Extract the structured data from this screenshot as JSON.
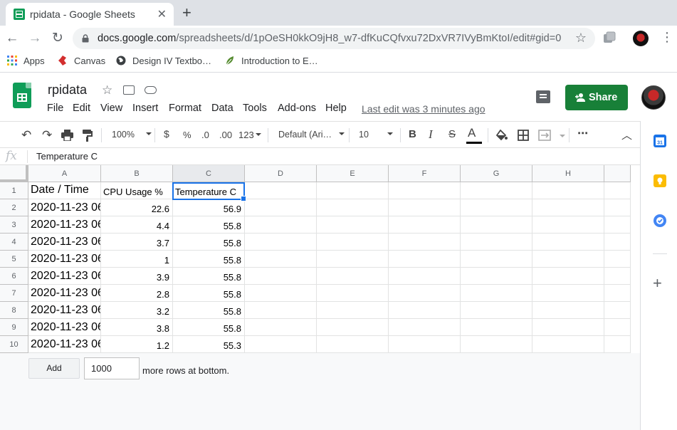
{
  "browser": {
    "tab_title": "rpidata - Google Sheets",
    "url_host": "docs.google.com",
    "url_path": "/spreadsheets/d/1pOeSH0kkO9jH8_w7-dfKuCQfvxu72DxVR7IVyBmKtoI/edit#gid=0",
    "bookmarks": [
      "Apps",
      "Canvas",
      "Design IV Textbo…",
      "Introduction to E…"
    ]
  },
  "sheets": {
    "title": "rpidata",
    "menu": [
      "File",
      "Edit",
      "View",
      "Insert",
      "Format",
      "Data",
      "Tools",
      "Add-ons",
      "Help"
    ],
    "last_edit": "Last edit was 3 minutes ago",
    "share_label": "Share"
  },
  "toolbar": {
    "zoom": "100%",
    "currency": "$",
    "percent": "%",
    "dec_decrease": ".0",
    "dec_increase": ".00",
    "number_format": "123",
    "font": "Default (Ari…",
    "font_size": "10",
    "bold": "B",
    "italic": "I",
    "strike": "S",
    "text_color": "A",
    "more": "⋯"
  },
  "formula_bar": {
    "fx": "fx",
    "value": "Temperature C"
  },
  "grid": {
    "columns": [
      "A",
      "B",
      "C",
      "D",
      "E",
      "F",
      "G",
      "H"
    ],
    "rows": [
      [
        "Date / Time",
        "CPU Usage %",
        "Temperature C"
      ],
      [
        "2020-11-23 06",
        "22.6",
        "56.9"
      ],
      [
        "2020-11-23 06",
        "4.4",
        "55.8"
      ],
      [
        "2020-11-23 06",
        "3.7",
        "55.8"
      ],
      [
        "2020-11-23 06",
        "1",
        "55.8"
      ],
      [
        "2020-11-23 06",
        "3.9",
        "55.8"
      ],
      [
        "2020-11-23 06",
        "2.8",
        "55.8"
      ],
      [
        "2020-11-23 06",
        "3.2",
        "55.8"
      ],
      [
        "2020-11-23 06",
        "3.8",
        "55.8"
      ],
      [
        "2020-11-23 06",
        "1.2",
        "55.3"
      ]
    ],
    "row_numbers": [
      "1",
      "2",
      "3",
      "4",
      "5",
      "6",
      "7",
      "8",
      "9",
      "10"
    ]
  },
  "add_rows": {
    "button_label": "Add",
    "count": "1000",
    "suffix": "more rows at bottom."
  },
  "colors": {
    "share_green": "#188038",
    "selection_blue": "#1a73e8"
  }
}
